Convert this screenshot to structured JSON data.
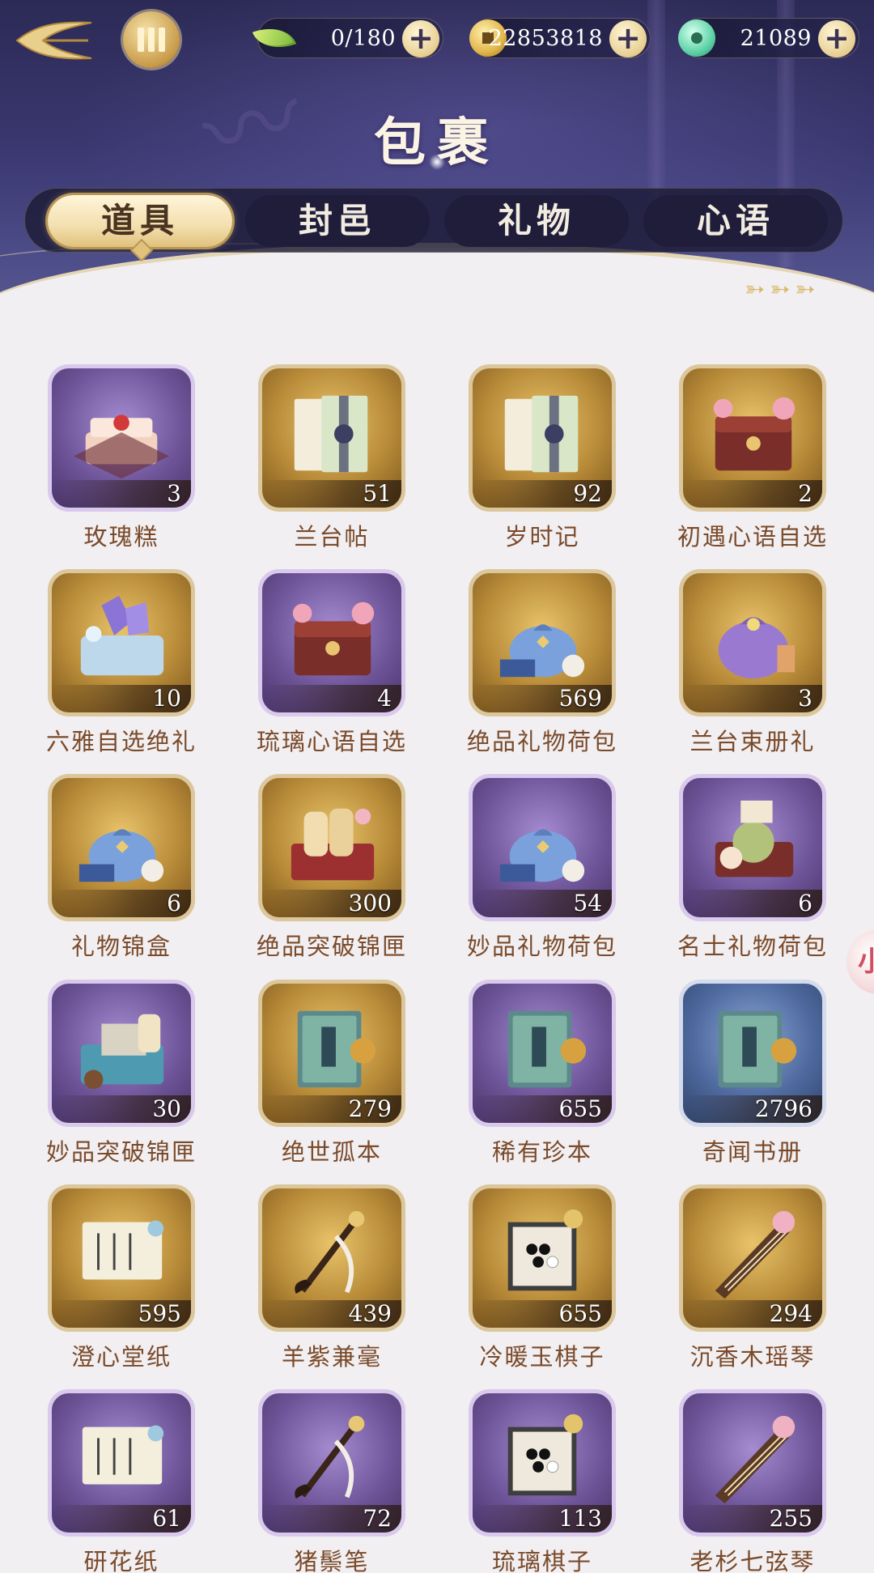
{
  "header": {
    "title": "包裹",
    "currencies": [
      {
        "name": "leaf",
        "value": "0/180"
      },
      {
        "name": "coin",
        "value": "22853818"
      },
      {
        "name": "jade",
        "value": "21089"
      }
    ],
    "plus_label": "+"
  },
  "tabs": [
    {
      "label": "道具",
      "active": true
    },
    {
      "label": "封邑",
      "active": false
    },
    {
      "label": "礼物",
      "active": false
    },
    {
      "label": "心语",
      "active": false
    }
  ],
  "side_button_label": "小",
  "items": [
    {
      "name": "玫瑰糕",
      "count": "3",
      "frame": "purple",
      "icon": "cake-icon"
    },
    {
      "name": "兰台帖",
      "count": "51",
      "frame": "gold",
      "icon": "letter-icon"
    },
    {
      "name": "岁时记",
      "count": "92",
      "frame": "gold",
      "icon": "letter-icon"
    },
    {
      "name": "初遇心语自选",
      "count": "2",
      "frame": "gold",
      "icon": "chest-icon"
    },
    {
      "name": "六雅自选绝礼",
      "count": "10",
      "frame": "gold",
      "icon": "crystal-box-icon"
    },
    {
      "name": "琉璃心语自选",
      "count": "4",
      "frame": "purple",
      "icon": "chest-icon"
    },
    {
      "name": "绝品礼物荷包",
      "count": "569",
      "frame": "gold",
      "icon": "gift-pouch-icon"
    },
    {
      "name": "兰台束册礼",
      "count": "3",
      "frame": "gold",
      "icon": "purple-pouch-icon"
    },
    {
      "name": "礼物锦盒",
      "count": "6",
      "frame": "gold",
      "icon": "gift-pouch-icon"
    },
    {
      "name": "绝品突破锦匣",
      "count": "300",
      "frame": "gold",
      "icon": "scroll-box-icon"
    },
    {
      "name": "妙品礼物荷包",
      "count": "54",
      "frame": "purple",
      "icon": "gift-pouch-icon"
    },
    {
      "name": "名士礼物荷包",
      "count": "6",
      "frame": "purple",
      "icon": "flower-box-icon"
    },
    {
      "name": "妙品突破锦匣",
      "count": "30",
      "frame": "purple",
      "icon": "go-box-icon"
    },
    {
      "name": "绝世孤本",
      "count": "279",
      "frame": "gold",
      "icon": "book-icon"
    },
    {
      "name": "稀有珍本",
      "count": "655",
      "frame": "purple",
      "icon": "book-icon"
    },
    {
      "name": "奇闻书册",
      "count": "2796",
      "frame": "blue",
      "icon": "book-icon"
    },
    {
      "name": "澄心堂纸",
      "count": "595",
      "frame": "gold",
      "icon": "paper-icon"
    },
    {
      "name": "羊紫兼毫",
      "count": "439",
      "frame": "gold",
      "icon": "brush-icon"
    },
    {
      "name": "冷暖玉棋子",
      "count": "655",
      "frame": "gold",
      "icon": "go-board-icon"
    },
    {
      "name": "沉香木瑶琴",
      "count": "294",
      "frame": "gold",
      "icon": "zither-icon"
    },
    {
      "name": "研花纸",
      "count": "61",
      "frame": "purple",
      "icon": "paper-icon"
    },
    {
      "name": "猪鬃笔",
      "count": "72",
      "frame": "purple",
      "icon": "brush-icon"
    },
    {
      "name": "琉璃棋子",
      "count": "113",
      "frame": "purple",
      "icon": "go-board-icon"
    },
    {
      "name": "老杉七弦琴",
      "count": "255",
      "frame": "purple",
      "icon": "zither-icon"
    }
  ]
}
